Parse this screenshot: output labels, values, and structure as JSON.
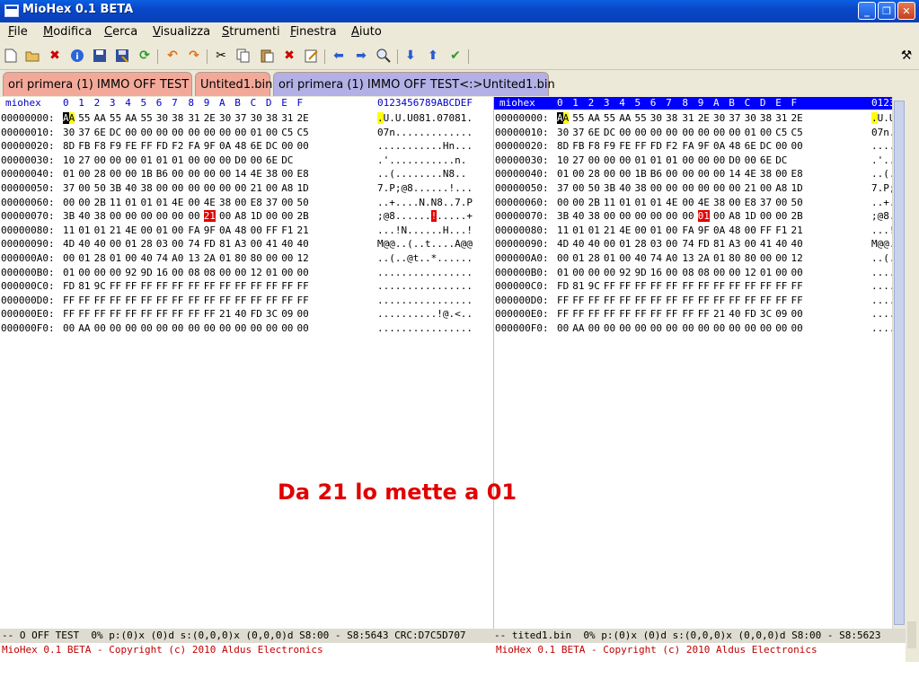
{
  "window": {
    "title": "MioHex 0.1 BETA",
    "minimize": "_",
    "maximize": "❐",
    "close": "✕"
  },
  "menu": [
    "File",
    "Modifica",
    "Cerca",
    "Visualizza",
    "Strumenti",
    "Finestra",
    "Aiuto"
  ],
  "menu_underline": [
    "F",
    "M",
    "C",
    "V",
    "S",
    "F",
    "A"
  ],
  "toolbar_icons": [
    "new-file-icon",
    "open-folder-icon",
    "close-file-icon",
    "info-icon",
    "save-icon",
    "save-as-icon",
    "refresh-icon",
    "undo-icon",
    "redo-icon",
    "cut-icon",
    "copy-icon",
    "paste-icon",
    "delete-icon",
    "edit-icon",
    "back-arrow-icon",
    "forward-arrow-icon",
    "find-icon",
    "down-arrow-icon",
    "up-arrow-icon",
    "checkmark-icon",
    "settings-tools-icon"
  ],
  "tabs": [
    {
      "label": "ori primera (1) IMMO OFF TEST",
      "color": "#f3a99a"
    },
    {
      "label": "Untited1.bin",
      "color": "#f3a99a"
    },
    {
      "label": "ori primera (1) IMMO OFF TEST<:>Untited1.bin",
      "color": "#b3b0e6"
    }
  ],
  "left": {
    "header_name": "miohex",
    "header_cols": [
      "0",
      "1",
      "2",
      "3",
      "4",
      "5",
      "6",
      "7",
      "8",
      "9",
      "A",
      "B",
      "C",
      "D",
      "E",
      "F"
    ],
    "header_ascii": "0123456789ABCDEF",
    "rows": [
      {
        "addr": "00000000:",
        "bytes": [
          "AA",
          "55",
          "AA",
          "55",
          "AA",
          "55",
          "30",
          "38",
          "31",
          "2E",
          "30",
          "37",
          "30",
          "38",
          "31",
          "2E"
        ],
        "ascii": ".U.U.U081.07081."
      },
      {
        "addr": "00000010:",
        "bytes": [
          "30",
          "37",
          "6E",
          "DC",
          "00",
          "00",
          "00",
          "00",
          "00",
          "00",
          "00",
          "00",
          "01",
          "00",
          "C5",
          "C5"
        ],
        "ascii": "07n............."
      },
      {
        "addr": "00000020:",
        "bytes": [
          "8D",
          "FB",
          "F8",
          "F9",
          "FE",
          "FF",
          "FD",
          "F2",
          "FA",
          "9F",
          "0A",
          "48",
          "6E",
          "DC",
          "00",
          "00"
        ],
        "ascii": "...........Hn..."
      },
      {
        "addr": "00000030:",
        "bytes": [
          "10",
          "27",
          "00",
          "00",
          "00",
          "01",
          "01",
          "01",
          "00",
          "00",
          "00",
          "D0",
          "00",
          "6E",
          "DC",
          ""
        ],
        "ascii": ".'...........n."
      },
      {
        "addr": "00000040:",
        "bytes": [
          "01",
          "00",
          "28",
          "00",
          "00",
          "1B",
          "B6",
          "00",
          "00",
          "00",
          "00",
          "14",
          "4E",
          "38",
          "00",
          "E8"
        ],
        "ascii": "..(........N8.."
      },
      {
        "addr": "00000050:",
        "bytes": [
          "37",
          "00",
          "50",
          "3B",
          "40",
          "38",
          "00",
          "00",
          "00",
          "00",
          "00",
          "00",
          "21",
          "00",
          "A8",
          "1D"
        ],
        "ascii": "7.P;@8......!..."
      },
      {
        "addr": "00000060:",
        "bytes": [
          "00",
          "00",
          "2B",
          "11",
          "01",
          "01",
          "01",
          "4E",
          "00",
          "4E",
          "38",
          "00",
          "E8",
          "37",
          "00",
          "50"
        ],
        "ascii": "..+....N.N8..7.P"
      },
      {
        "addr": "00000070:",
        "bytes": [
          "3B",
          "40",
          "38",
          "00",
          "00",
          "00",
          "00",
          "00",
          "00",
          "21",
          "00",
          "A8",
          "1D",
          "00",
          "00",
          "2B"
        ],
        "ascii": ";@8......!.....+"
      },
      {
        "addr": "00000080:",
        "bytes": [
          "11",
          "01",
          "01",
          "21",
          "4E",
          "00",
          "01",
          "00",
          "FA",
          "9F",
          "0A",
          "48",
          "00",
          "FF",
          "F1",
          "21"
        ],
        "ascii": "...!N......H...!"
      },
      {
        "addr": "00000090:",
        "bytes": [
          "4D",
          "40",
          "40",
          "00",
          "01",
          "28",
          "03",
          "00",
          "74",
          "FD",
          "81",
          "A3",
          "00",
          "41",
          "40",
          "40"
        ],
        "ascii": "M@@..(..t....A@@"
      },
      {
        "addr": "000000A0:",
        "bytes": [
          "00",
          "01",
          "28",
          "01",
          "00",
          "40",
          "74",
          "A0",
          "13",
          "2A",
          "01",
          "80",
          "80",
          "00",
          "00",
          "12"
        ],
        "ascii": "..(..@t..*......"
      },
      {
        "addr": "000000B0:",
        "bytes": [
          "01",
          "00",
          "00",
          "00",
          "92",
          "9D",
          "16",
          "00",
          "08",
          "08",
          "00",
          "00",
          "12",
          "01",
          "00",
          "00"
        ],
        "ascii": "................"
      },
      {
        "addr": "000000C0:",
        "bytes": [
          "FD",
          "81",
          "9C",
          "FF",
          "FF",
          "FF",
          "FF",
          "FF",
          "FF",
          "FF",
          "FF",
          "FF",
          "FF",
          "FF",
          "FF",
          "FF"
        ],
        "ascii": "................"
      },
      {
        "addr": "000000D0:",
        "bytes": [
          "FF",
          "FF",
          "FF",
          "FF",
          "FF",
          "FF",
          "FF",
          "FF",
          "FF",
          "FF",
          "FF",
          "FF",
          "FF",
          "FF",
          "FF",
          "FF"
        ],
        "ascii": "................"
      },
      {
        "addr": "000000E0:",
        "bytes": [
          "FF",
          "FF",
          "FF",
          "FF",
          "FF",
          "FF",
          "FF",
          "FF",
          "FF",
          "FF",
          "21",
          "40",
          "FD",
          "3C",
          "09",
          "00"
        ],
        "ascii": "..........!@.<.."
      },
      {
        "addr": "000000F0:",
        "bytes": [
          "00",
          "AA",
          "00",
          "00",
          "00",
          "00",
          "00",
          "00",
          "00",
          "00",
          "00",
          "00",
          "00",
          "00",
          "00",
          "00"
        ],
        "ascii": "................"
      }
    ]
  },
  "right": {
    "header_name": "miohex",
    "header_cols": [
      "0",
      "1",
      "2",
      "3",
      "4",
      "5",
      "6",
      "7",
      "8",
      "9",
      "A",
      "B",
      "C",
      "D",
      "E",
      "F"
    ],
    "header_ascii": "01234",
    "rows": [
      {
        "addr": "00000000:",
        "bytes": [
          "AA",
          "55",
          "AA",
          "55",
          "AA",
          "55",
          "30",
          "38",
          "31",
          "2E",
          "30",
          "37",
          "30",
          "38",
          "31",
          "2E"
        ],
        "ascii": ".U.U"
      },
      {
        "addr": "00000010:",
        "bytes": [
          "30",
          "37",
          "6E",
          "DC",
          "00",
          "00",
          "00",
          "00",
          "00",
          "00",
          "00",
          "00",
          "01",
          "00",
          "C5",
          "C5"
        ],
        "ascii": "07n.."
      },
      {
        "addr": "00000020:",
        "bytes": [
          "8D",
          "FB",
          "F8",
          "F9",
          "FE",
          "FF",
          "FD",
          "F2",
          "FA",
          "9F",
          "0A",
          "48",
          "6E",
          "DC",
          "00",
          "00"
        ],
        "ascii": "....."
      },
      {
        "addr": "00000030:",
        "bytes": [
          "10",
          "27",
          "00",
          "00",
          "00",
          "01",
          "01",
          "01",
          "00",
          "00",
          "00",
          "D0",
          "00",
          "6E",
          "DC",
          ""
        ],
        "ascii": ".'..."
      },
      {
        "addr": "00000040:",
        "bytes": [
          "01",
          "00",
          "28",
          "00",
          "00",
          "1B",
          "B6",
          "00",
          "00",
          "00",
          "00",
          "14",
          "4E",
          "38",
          "00",
          "E8"
        ],
        "ascii": "..(.."
      },
      {
        "addr": "00000050:",
        "bytes": [
          "37",
          "00",
          "50",
          "3B",
          "40",
          "38",
          "00",
          "00",
          "00",
          "00",
          "00",
          "00",
          "21",
          "00",
          "A8",
          "1D"
        ],
        "ascii": "7.P;@"
      },
      {
        "addr": "00000060:",
        "bytes": [
          "00",
          "00",
          "2B",
          "11",
          "01",
          "01",
          "01",
          "4E",
          "00",
          "4E",
          "38",
          "00",
          "E8",
          "37",
          "00",
          "50"
        ],
        "ascii": "..+.."
      },
      {
        "addr": "00000070:",
        "bytes": [
          "3B",
          "40",
          "38",
          "00",
          "00",
          "00",
          "00",
          "00",
          "00",
          "01",
          "00",
          "A8",
          "1D",
          "00",
          "00",
          "2B"
        ],
        "ascii": ";@8.."
      },
      {
        "addr": "00000080:",
        "bytes": [
          "11",
          "01",
          "01",
          "21",
          "4E",
          "00",
          "01",
          "00",
          "FA",
          "9F",
          "0A",
          "48",
          "00",
          "FF",
          "F1",
          "21"
        ],
        "ascii": "...!N"
      },
      {
        "addr": "00000090:",
        "bytes": [
          "4D",
          "40",
          "40",
          "00",
          "01",
          "28",
          "03",
          "00",
          "74",
          "FD",
          "81",
          "A3",
          "00",
          "41",
          "40",
          "40"
        ],
        "ascii": "M@@.."
      },
      {
        "addr": "000000A0:",
        "bytes": [
          "00",
          "01",
          "28",
          "01",
          "00",
          "40",
          "74",
          "A0",
          "13",
          "2A",
          "01",
          "80",
          "80",
          "00",
          "00",
          "12"
        ],
        "ascii": "..(.."
      },
      {
        "addr": "000000B0:",
        "bytes": [
          "01",
          "00",
          "00",
          "00",
          "92",
          "9D",
          "16",
          "00",
          "08",
          "08",
          "00",
          "00",
          "12",
          "01",
          "00",
          "00"
        ],
        "ascii": "....."
      },
      {
        "addr": "000000C0:",
        "bytes": [
          "FD",
          "81",
          "9C",
          "FF",
          "FF",
          "FF",
          "FF",
          "FF",
          "FF",
          "FF",
          "FF",
          "FF",
          "FF",
          "FF",
          "FF",
          "FF"
        ],
        "ascii": "....."
      },
      {
        "addr": "000000D0:",
        "bytes": [
          "FF",
          "FF",
          "FF",
          "FF",
          "FF",
          "FF",
          "FF",
          "FF",
          "FF",
          "FF",
          "FF",
          "FF",
          "FF",
          "FF",
          "FF",
          "FF"
        ],
        "ascii": "....."
      },
      {
        "addr": "000000E0:",
        "bytes": [
          "FF",
          "FF",
          "FF",
          "FF",
          "FF",
          "FF",
          "FF",
          "FF",
          "FF",
          "FF",
          "21",
          "40",
          "FD",
          "3C",
          "09",
          "00"
        ],
        "ascii": "....."
      },
      {
        "addr": "000000F0:",
        "bytes": [
          "00",
          "AA",
          "00",
          "00",
          "00",
          "00",
          "00",
          "00",
          "00",
          "00",
          "00",
          "00",
          "00",
          "00",
          "00",
          "00"
        ],
        "ascii": "....."
      }
    ]
  },
  "highlights": {
    "cursor_row": 0,
    "cursor_col": 0,
    "diff_row": 7,
    "diff_col": 9,
    "colors": {
      "cursor": "#000000",
      "cursor_half": "#ffff00",
      "diff": "#e00000"
    }
  },
  "annotation": "Da 21 lo mette a 01",
  "status_left": "-- O OFF TEST  0% p:(0)x (0)d s:(0,0,0)x (0,0,0)d S8:00 - S8:5643 CRC:D7C5D707",
  "status_right": "-- tited1.bin  0% p:(0)x (0)d s:(0,0,0)x (0,0,0)d S8:00 - S8:5623",
  "copyright_left": "MioHex 0.1 BETA - Copyright (c) 2010 Aldus Electronics",
  "copyright_right": "MioHex 0.1 BETA - Copyright (c) 2010 Aldus Electronics"
}
